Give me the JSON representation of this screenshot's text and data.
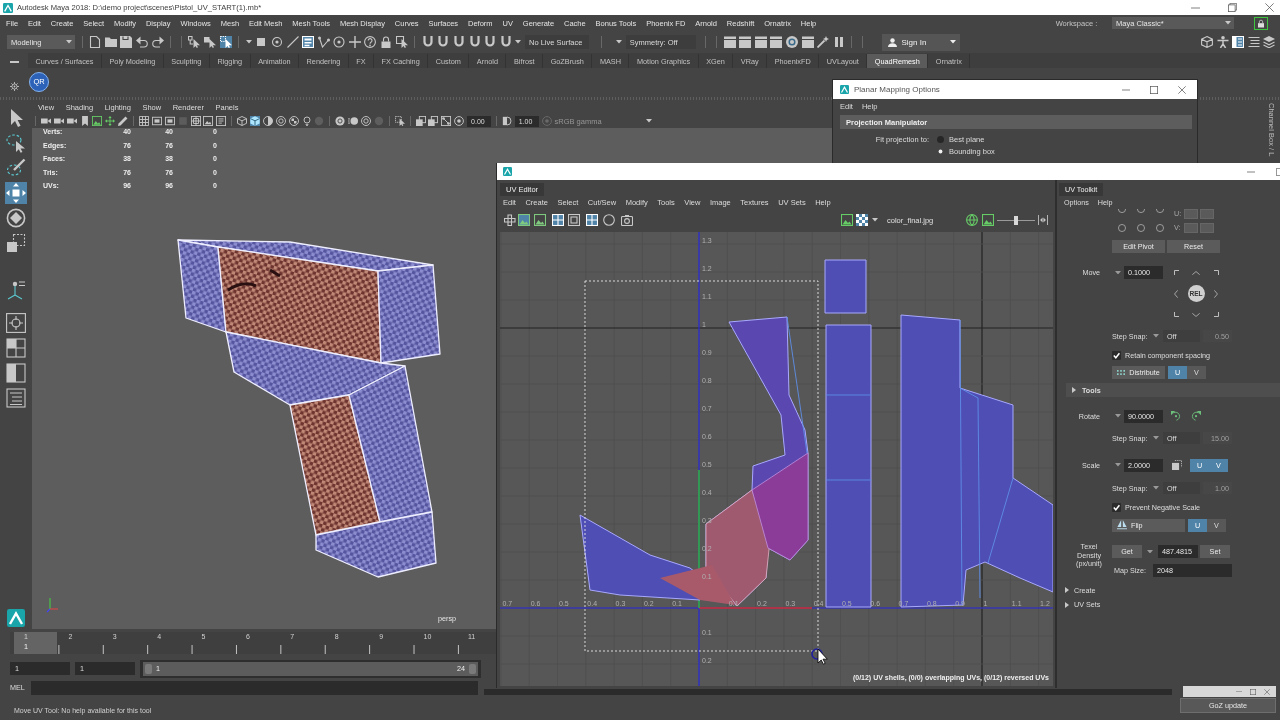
{
  "window": {
    "title": "Autodesk Maya 2018: D:\\demo project\\scenes\\Pistol_UV_START(1).mb*"
  },
  "menu_bar": {
    "items": [
      "File",
      "Edit",
      "Create",
      "Select",
      "Modify",
      "Display",
      "Windows",
      "Mesh",
      "Edit Mesh",
      "Mesh Tools",
      "Mesh Display",
      "Curves",
      "Surfaces",
      "Deform",
      "UV",
      "Generate",
      "Cache",
      "Bonus Tools",
      "Phoenix FD",
      "Arnold",
      "Redshift",
      "Ornatrix",
      "Help"
    ],
    "workspace_label": "Workspace :",
    "workspace": "Maya Classic*"
  },
  "status_line": {
    "mode": "Modeling",
    "tools": [
      {
        "on": false
      },
      {
        "on": false
      },
      {
        "on": false
      },
      {
        "on": false
      },
      {
        "on": false
      },
      {
        "on": false
      },
      {
        "on": false
      },
      {
        "on": true
      },
      {
        "on": false
      },
      {
        "on": false
      },
      {
        "on": false
      },
      {
        "on": true
      },
      {
        "on": false
      },
      {
        "on": false
      },
      {
        "on": false
      },
      {
        "on": false
      },
      {
        "on": false
      },
      {
        "on": false
      },
      {
        "on": false
      },
      {
        "on": false
      },
      {
        "on": false
      },
      {
        "on": false
      },
      {
        "on": false
      },
      {
        "on": false
      },
      {
        "on": false
      },
      {
        "on": false
      },
      {
        "on": false
      },
      {
        "on": false
      },
      {
        "on": false
      },
      {
        "on": false
      },
      {
        "on": false
      },
      {
        "on": false
      },
      {
        "on": false
      },
      {
        "on": false
      },
      {
        "on": true
      },
      {
        "on": false
      },
      {
        "on": false
      }
    ],
    "live_surface": "No Live Surface",
    "symmetry": "Symmetry: Off",
    "sign_in": "Sign In"
  },
  "shelf": {
    "tabs": [
      {
        "label": "Curves / Surfaces",
        "selected": false
      },
      {
        "label": "Poly Modeling",
        "selected": false
      },
      {
        "label": "Sculpting",
        "selected": false
      },
      {
        "label": "Rigging",
        "selected": false
      },
      {
        "label": "Animation",
        "selected": false
      },
      {
        "label": "Rendering",
        "selected": false
      },
      {
        "label": "FX",
        "selected": false
      },
      {
        "label": "FX Caching",
        "selected": false
      },
      {
        "label": "Custom",
        "selected": false
      },
      {
        "label": "Arnold",
        "selected": false
      },
      {
        "label": "Bifrost",
        "selected": false
      },
      {
        "label": "GoZBrush",
        "selected": false
      },
      {
        "label": "MASH",
        "selected": false
      },
      {
        "label": "Motion Graphics",
        "selected": false
      },
      {
        "label": "XGen",
        "selected": false
      },
      {
        "label": "VRay",
        "selected": false
      },
      {
        "label": "PhoenixFD",
        "selected": false
      },
      {
        "label": "UVLayout",
        "selected": false
      },
      {
        "label": "QuadRemesh",
        "selected": true
      },
      {
        "label": "Ornatrix",
        "selected": false
      }
    ],
    "buttons": [
      "QR"
    ]
  },
  "toolbox": {
    "tools": [
      {
        "selected": false
      },
      {
        "selected": false
      },
      {
        "selected": false
      },
      {
        "selected": true
      },
      {
        "selected": false
      },
      {
        "selected": false
      },
      {
        "selected": false
      },
      {
        "selected": false
      },
      {
        "selected": false
      },
      {
        "selected": false
      },
      {
        "selected": false
      }
    ]
  },
  "viewport": {
    "menus": [
      "View",
      "Shading",
      "Lighting",
      "Show",
      "Renderer",
      "Panels"
    ],
    "toolbar": [
      {
        "on": false
      },
      {
        "on": false
      },
      {
        "on": false
      },
      {
        "on": false
      },
      {
        "on": false
      },
      {
        "on": false
      },
      {
        "on": false
      },
      {
        "on": false
      },
      {
        "on": false
      },
      {
        "on": false
      },
      {
        "on": false
      },
      {
        "on": false
      },
      {
        "on": false
      },
      {
        "on": false
      },
      {
        "on": false
      },
      {
        "on": true
      },
      {
        "on": false
      },
      {
        "on": false
      },
      {
        "on": false
      },
      {
        "on": false
      },
      {
        "on": false
      },
      {
        "on": false
      },
      {
        "on": false
      },
      {
        "on": false
      },
      {
        "on": false
      },
      {
        "on": false
      },
      {
        "on": false
      },
      {
        "on": false
      },
      {
        "on": false
      }
    ],
    "exposure": "0.00",
    "gamma": "1.00",
    "view_transform": {
      "label": "sRGB gamma",
      "disabled": true
    },
    "hud": [
      {
        "label": "Verts:",
        "values": [
          "40",
          "40",
          "0"
        ]
      },
      {
        "label": "Edges:",
        "values": [
          "76",
          "76",
          "0"
        ]
      },
      {
        "label": "Faces:",
        "values": [
          "38",
          "38",
          "0"
        ]
      },
      {
        "label": "Tris:",
        "values": [
          "76",
          "76",
          "0"
        ]
      },
      {
        "label": "UVs:",
        "values": [
          "96",
          "96",
          "0"
        ]
      }
    ],
    "camera": "persp"
  },
  "channel_box": {
    "label": "Channel Box / L"
  },
  "planar_mapping": {
    "title": "Planar Mapping Options",
    "menus": [
      "Edit",
      "Help"
    ],
    "section": "Projection Manipulator",
    "fit_label": "Fit projection to:",
    "options": [
      {
        "label": "Best plane",
        "selected": false
      },
      {
        "label": "Bounding box",
        "selected": true
      }
    ]
  },
  "uv_editor": {
    "tab": "UV Editor",
    "menus": [
      "Edit",
      "Create",
      "Select",
      "Cut/Sew",
      "Modify",
      "Tools",
      "View",
      "Image",
      "Textures",
      "UV Sets",
      "Help"
    ],
    "toolbar": [
      {
        "on": false
      },
      {
        "on": true
      },
      {
        "on": false
      },
      {
        "on": true
      },
      {
        "on": false
      },
      {
        "on": true
      },
      {
        "on": false
      },
      {
        "on": false
      }
    ],
    "view_toggles": [
      {
        "on": false
      },
      {
        "on": true
      }
    ],
    "texture": "color_final.jpg",
    "brightness": {
      "level": 0.5
    },
    "u_labels": {
      "negative": [
        "0.7",
        "0.6",
        "0.5",
        "0.4",
        "0.3",
        "0.2",
        "0.1"
      ],
      "positive": [
        "0.1",
        "0.2",
        "0.3",
        "0.4",
        "0.5",
        "0.6",
        "0.7",
        "0.8",
        "0.9",
        "1",
        "1.1",
        "1.2"
      ]
    },
    "v_labels": {
      "positive": [
        "1.3",
        "1.2",
        "1.1",
        "1",
        "0.9",
        "0.8",
        "0.7",
        "0.6",
        "0.5",
        "0.4",
        "0.3",
        "0.2",
        "0.1"
      ],
      "negative": [
        "0.1",
        "0.2"
      ]
    },
    "stats": "(0/12) UV shells, (0/0) overlapping UVs, (0/12) reversed UVs"
  },
  "uv_toolkit": {
    "tab": "UV Toolkit",
    "menus": [
      "Options",
      "Help"
    ],
    "pivot_labels": [
      "U:",
      "V:"
    ],
    "pivot_buttons": [
      "Edit Pivot",
      "Reset"
    ],
    "move": {
      "label": "Move",
      "value": "0.1000",
      "center": "REL"
    },
    "move_snap": {
      "label": "Step Snap:",
      "value": "Off",
      "step": "0.50",
      "step_disabled": true
    },
    "retain_spacing": {
      "label": "Retain component spacing",
      "checked": true
    },
    "distribute": {
      "label": "Distribute",
      "axes": [
        {
          "label": "U",
          "selected": true
        },
        {
          "label": "V",
          "selected": false
        }
      ]
    },
    "tools_section": {
      "label": "Tools",
      "expanded": false
    },
    "rotate": {
      "label": "Rotate",
      "value": "90.0000"
    },
    "rotate_snap": {
      "label": "Step Snap:",
      "value": "Off",
      "step": "15.00",
      "step_disabled": true
    },
    "scale": {
      "label": "Scale",
      "value": "2.0000",
      "axes": [
        {
          "label": "U",
          "selected": true
        },
        {
          "label": "V",
          "selected": true
        }
      ]
    },
    "scale_snap": {
      "label": "Step Snap:",
      "value": "Off",
      "step": "1.00",
      "step_disabled": true
    },
    "prevent_negative": {
      "label": "Prevent Negative Scale",
      "checked": true
    },
    "flip": {
      "label": "Flip",
      "axes": [
        {
          "label": "U",
          "selected": true
        },
        {
          "label": "V",
          "selected": false
        }
      ]
    },
    "texel_density": {
      "label": "Texel Density (px/unit)",
      "get": "Get",
      "value": "487.4815",
      "set": "Set",
      "map_size_label": "Map Size:",
      "map_size": "2048"
    },
    "sections": [
      {
        "label": "Create",
        "expanded": false
      },
      {
        "label": "UV Sets",
        "expanded": false
      }
    ]
  },
  "time_slider": {
    "frames": [
      "1",
      "2",
      "3",
      "4",
      "5",
      "6",
      "7",
      "8",
      "9",
      "10",
      "11"
    ],
    "current_frame": "1",
    "level": 0
  },
  "range_slider": {
    "start": "1",
    "playback_start": "1",
    "range_start": "1",
    "range_end": "24",
    "level": 1
  },
  "command_line": {
    "language": "MEL"
  },
  "help_line": "Move UV Tool: No help available for this tool",
  "goz": {
    "button": "GoZ update"
  }
}
